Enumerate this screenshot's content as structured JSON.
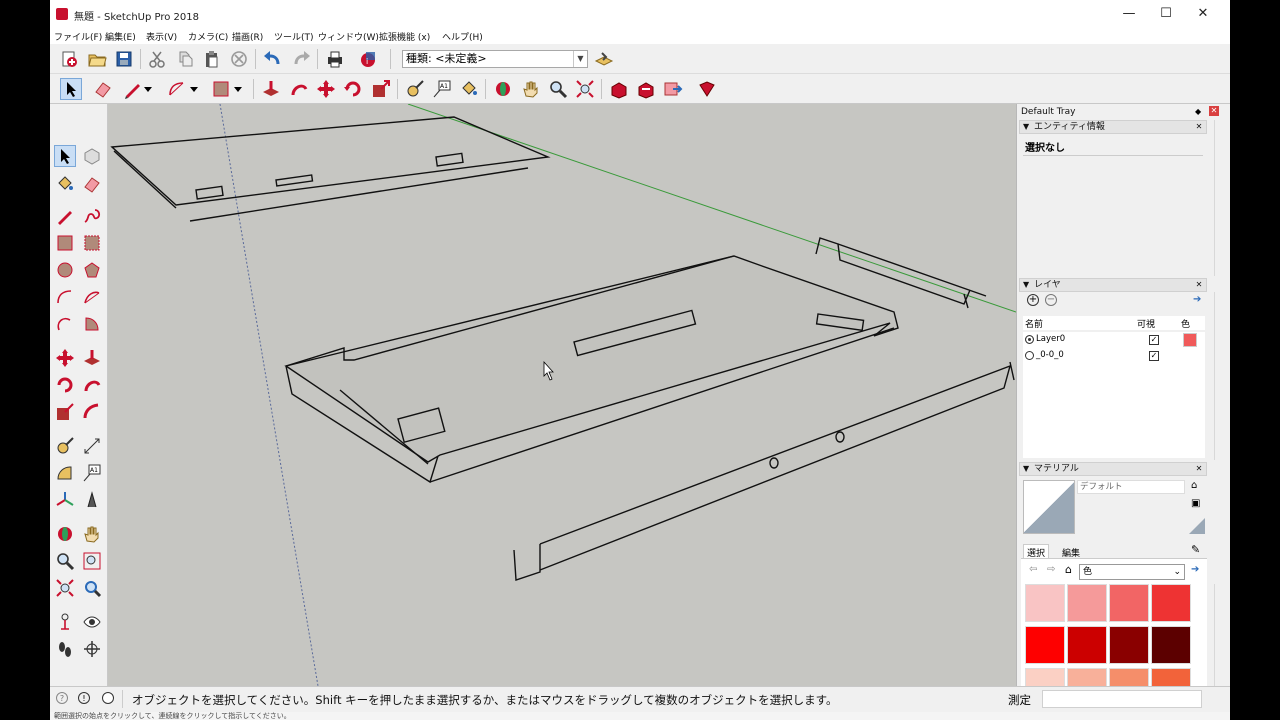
{
  "window": {
    "title": "無題 - SketchUp Pro 2018",
    "minimize": "—",
    "maximize": "☐",
    "close": "✕"
  },
  "menu": [
    "ファイル(F)",
    "編集(E)",
    "表示(V)",
    "カメラ(C)",
    "描画(R)",
    "ツール(T)",
    "ウィンドウ(W)",
    "拡張機能 (x)",
    "ヘルプ(H)"
  ],
  "layer_combo": {
    "value": "種類: <未定義>"
  },
  "tray": {
    "title": "Default Tray",
    "entity_info": {
      "title": "エンティティ情報",
      "value": "選択なし"
    },
    "layers": {
      "title": "レイヤ",
      "col_name": "名前",
      "col_visible": "可視",
      "col_color": "色",
      "rows": [
        {
          "name": "Layer0",
          "active": true,
          "visible": true,
          "color": "#f05a5a"
        },
        {
          "name": "_0-0_0",
          "active": false,
          "visible": true,
          "color": ""
        }
      ]
    },
    "materials": {
      "title": "マテリアル",
      "name": "デフォルト",
      "tab_select": "選択",
      "tab_edit": "編集",
      "library": "色",
      "swatches": [
        "#f9c4c4",
        "#f59a9a",
        "#f26565",
        "#ee3333",
        "#fe0000",
        "#cc0000",
        "#8a0000",
        "#5c0000",
        "#fbd0c4",
        "#f8b09a",
        "#f58e6a",
        "#f2633a"
      ]
    }
  },
  "status": {
    "message": "オブジェクトを選択してください。Shift キーを押したまま選択するか、またはマウスをドラッグして複数のオブジェクトを選択します。",
    "measure_label": "測定",
    "measure_value": ""
  },
  "under_caption": "範囲選択の始点をクリックして、連続線をクリックして指示してください。"
}
